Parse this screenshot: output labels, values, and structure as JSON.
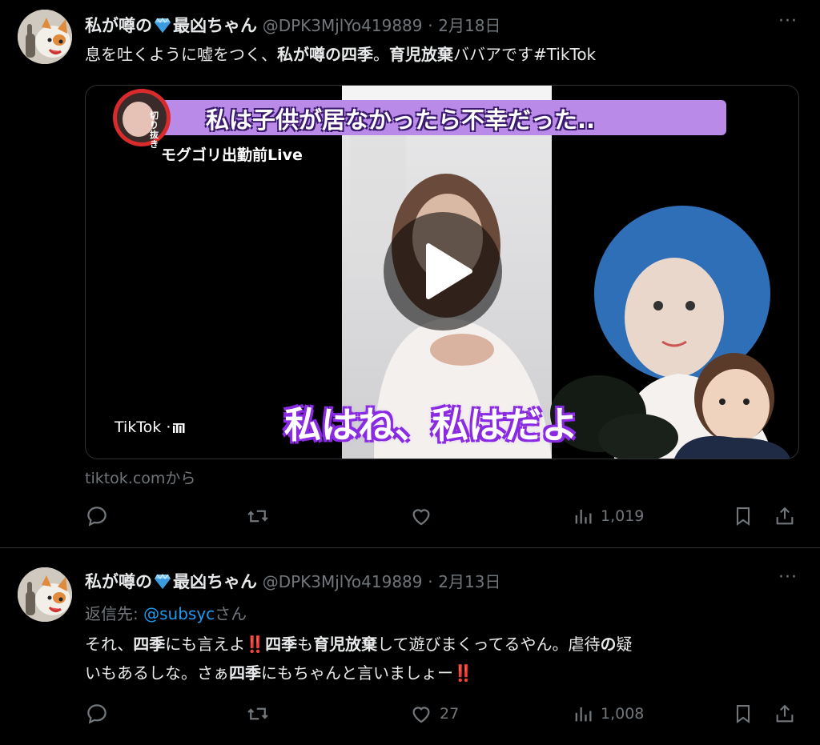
{
  "tweets": [
    {
      "author_name": "私が噂の",
      "author_name_suffix": "最凶ちゃん",
      "handle": "@DPK3MjlYo419889",
      "dot": "·",
      "date": "2月18日",
      "text_parts": [
        "息を吐くように嘘をつく、",
        "私が噂の四季",
        "。",
        "育児放棄",
        "ババアです#TikTok"
      ],
      "media": {
        "banner_text": "私は子供が居なかったら不幸だった..",
        "sub_label": "モグゴリ出勤前Live",
        "badge_text": "切り抜き",
        "caption": "私はね、私はだよ",
        "platform": "TikTok · ",
        "platform_icon": "tiktok-bars-icon"
      },
      "source": "tiktok.comから",
      "views": "1,019"
    },
    {
      "author_name": "私が噂の",
      "author_name_suffix": "最凶ちゃん",
      "handle": "@DPK3MjlYo419889",
      "dot": "·",
      "date": "2月13日",
      "reply_label": "返信先: ",
      "reply_handle": "@subsyc",
      "reply_suffix": "さん",
      "line1_parts": [
        "それ、",
        "四季",
        "にも言えよ",
        "‼️",
        "四季",
        "も",
        "育児放棄",
        "して遊びまくってるやん。虐待",
        "の",
        "疑"
      ],
      "line2_parts": [
        "いもあるしな。さぁ",
        "四季",
        "にもちゃんと言いましょー",
        "‼️"
      ],
      "likes": "27",
      "views": "1,008"
    }
  ],
  "colors": {
    "accent": "#1d9bf0",
    "muted": "#71767b",
    "text": "#e7e9ea",
    "banner": "#b98ae8"
  }
}
